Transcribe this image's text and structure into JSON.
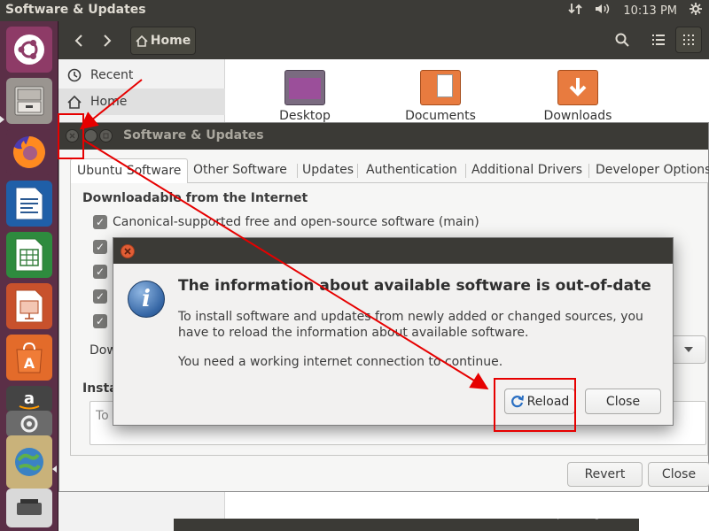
{
  "top_panel": {
    "title": "Software & Updates",
    "time": "10:13 PM",
    "icons": [
      "network-arrows-icon",
      "volume-icon",
      "power-gear-icon"
    ]
  },
  "launcher": {
    "items": [
      "ubuntu-dash-icon",
      "files-icon",
      "firefox-icon",
      "writer-icon",
      "calc-icon",
      "impress-icon",
      "software-center-icon",
      "amazon-icon",
      "settings-icon",
      "software-updates-icon",
      "usb-drive-icon"
    ]
  },
  "files": {
    "path_label": "Home",
    "sidebar": [
      {
        "label": "Recent",
        "icon": "clock-icon"
      },
      {
        "label": "Home",
        "icon": "home-icon"
      }
    ],
    "folders": [
      "Desktop",
      "Documents",
      "Downloads"
    ]
  },
  "software_updates": {
    "title": "Software & Updates",
    "tabs": [
      "Ubuntu Software",
      "Other Software",
      "Updates",
      "Authentication",
      "Additional Drivers",
      "Developer Options"
    ],
    "section_downloadable": "Downloadable from the Internet",
    "checkbox_main": "Canonical-supported free and open-source software (main)",
    "partial_label_dow": "Dow",
    "partial_label_insta": "Insta",
    "partial_field_to": "To",
    "revert_label": "Revert",
    "close_label": "Close"
  },
  "dialog": {
    "heading": "The information about available software is out-of-date",
    "body1": "To install software and updates from newly added or changed sources, you have to reload the information about available software.",
    "body2": "You need a working internet connection to continue.",
    "reload_label": "Reload",
    "close_label": "Close"
  },
  "watermark": "https://blog.csdn.net/superica_",
  "colors": {
    "launcher_bg": "#5b2f47",
    "panel_bg": "#3c3b37",
    "annotation_red": "#e60000",
    "close_orange": "#e15d35"
  }
}
